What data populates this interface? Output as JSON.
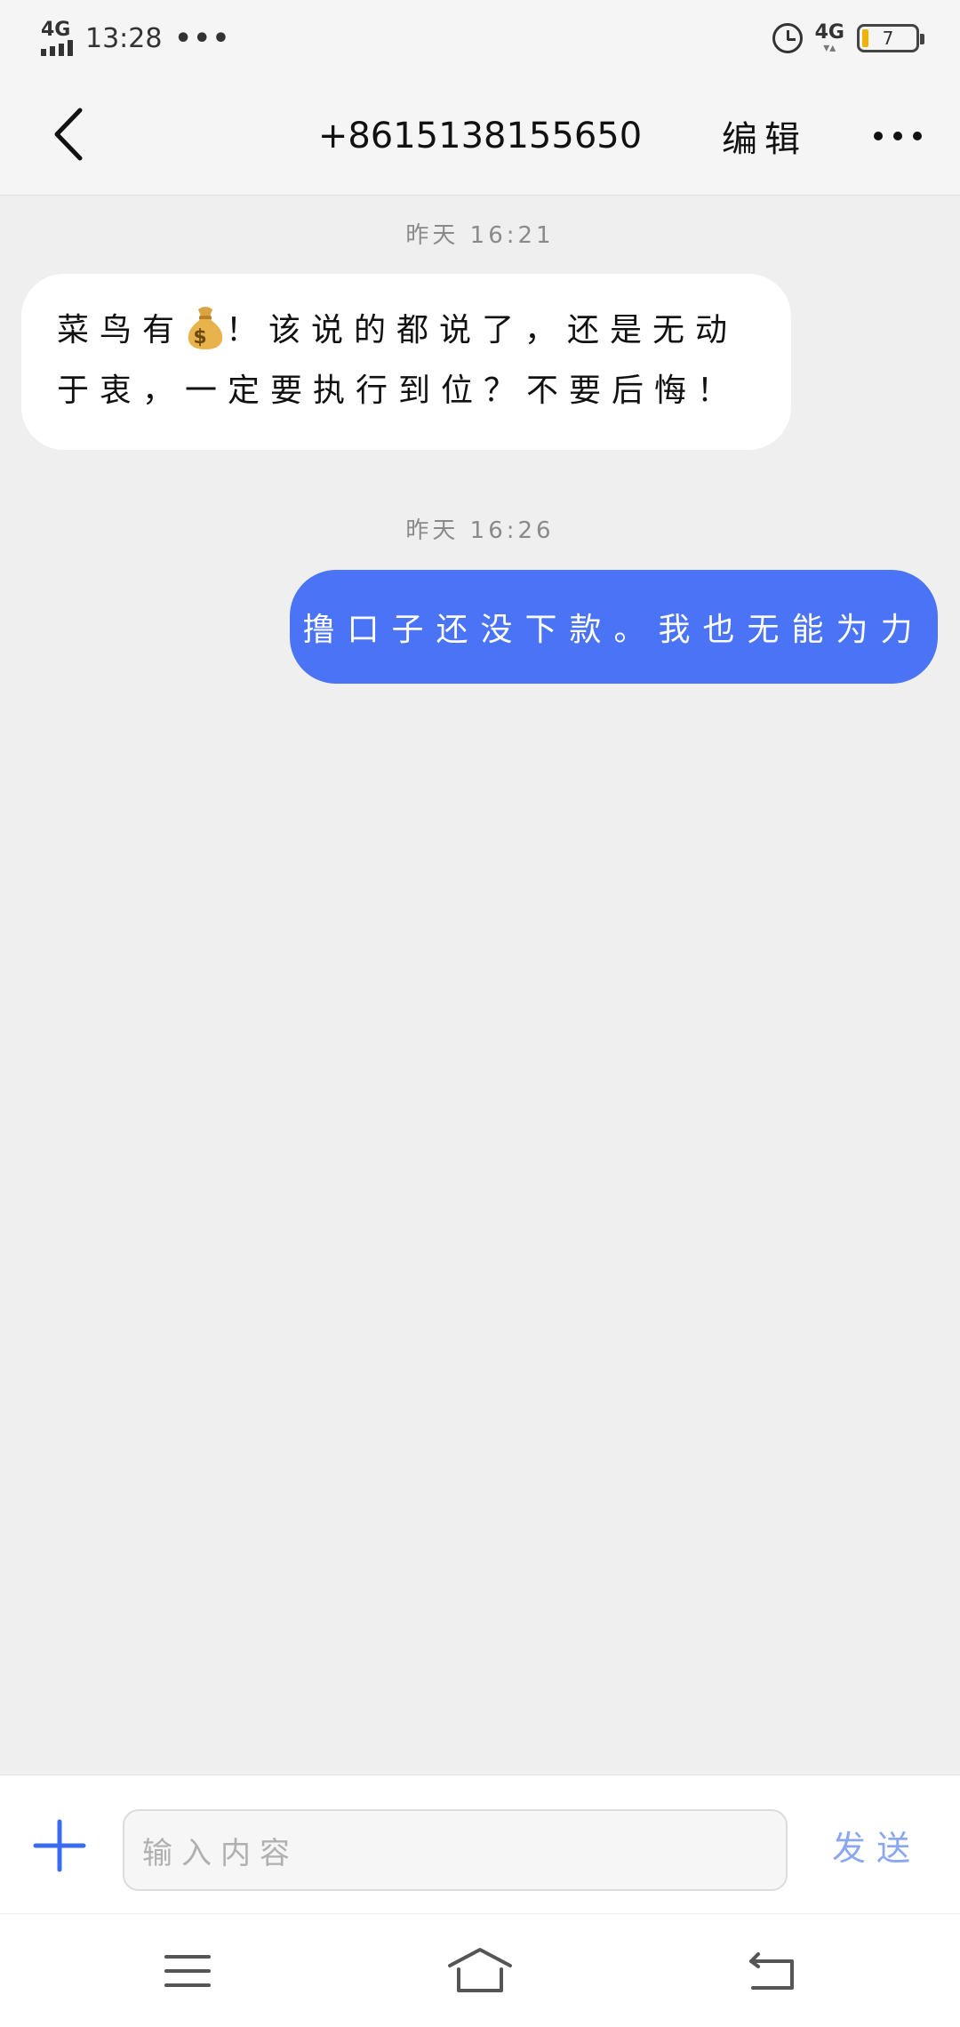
{
  "status_bar": {
    "network_left": "4G",
    "time": "13:28",
    "dots": "•••",
    "network_right": "4G",
    "battery_level": "7"
  },
  "header": {
    "title": "+8615138155650",
    "edit_label": "编辑"
  },
  "messages": [
    {
      "direction": "incoming",
      "timestamp": "昨天 16:21",
      "text_before_emoji": "菜鸟有",
      "emoji": "money-bag",
      "text_after_emoji": "！该说的都说了，还是无动于衷，一定要执行到位？不要后悔！"
    },
    {
      "direction": "outgoing",
      "timestamp": "昨天 16:26",
      "text": "撸口子还没下款。我也无能为力"
    }
  ],
  "input_bar": {
    "placeholder": "输入内容",
    "send_label": "发送"
  },
  "colors": {
    "outgoing_bubble": "#4a74f5",
    "accent_blue": "#3b6cf0",
    "send_text": "#8aa8f0",
    "background": "#efefef"
  }
}
